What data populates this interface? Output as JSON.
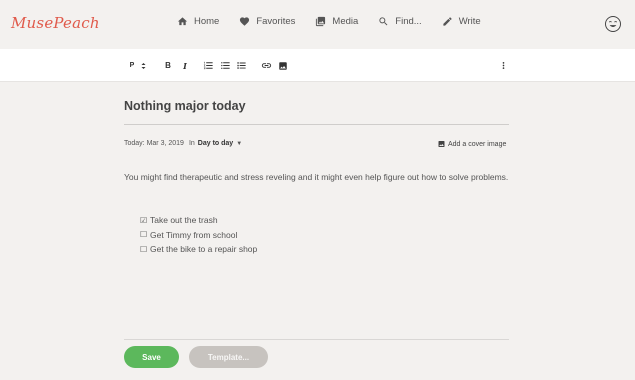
{
  "app": {
    "logo_text": "MusePeach"
  },
  "nav": {
    "items": [
      {
        "label": "Home",
        "icon": "home-icon"
      },
      {
        "label": "Favorites",
        "icon": "heart-icon"
      },
      {
        "label": "Media",
        "icon": "media-icon"
      },
      {
        "label": "Find...",
        "icon": "search-icon"
      },
      {
        "label": "Write",
        "icon": "pencil-icon"
      }
    ],
    "profile_icon": "smiley-icon"
  },
  "toolbar": {
    "paragraph_label": "P",
    "bold_label": "B",
    "italic_label": "I",
    "buttons": [
      "paragraph-select",
      "bold",
      "italic",
      "ordered-list",
      "bullet-list",
      "checklist",
      "link",
      "image",
      "more"
    ]
  },
  "entry": {
    "title": "Nothing major today",
    "date_text": "Today: Mar 3, 2019",
    "in_label": "In",
    "category": "Day to day",
    "cover_image_label": "Add a cover image",
    "paragraph": "You might find therapeutic and stress reveling and it might even help figure out how to solve problems.",
    "checklist": [
      {
        "box": "☑",
        "text": "Take out the trash",
        "checked": true
      },
      {
        "box": "☐",
        "text": "Get Timmy from school",
        "checked": false
      },
      {
        "box": "☐",
        "text": "Get the bike to a repair shop",
        "checked": false
      }
    ]
  },
  "actions": {
    "save_label": "Save",
    "template_label": "Template..."
  },
  "colors": {
    "brand": "#e05a4b",
    "save": "#5cb85c",
    "template": "#c7c3bf",
    "background": "#f3f1ef"
  }
}
